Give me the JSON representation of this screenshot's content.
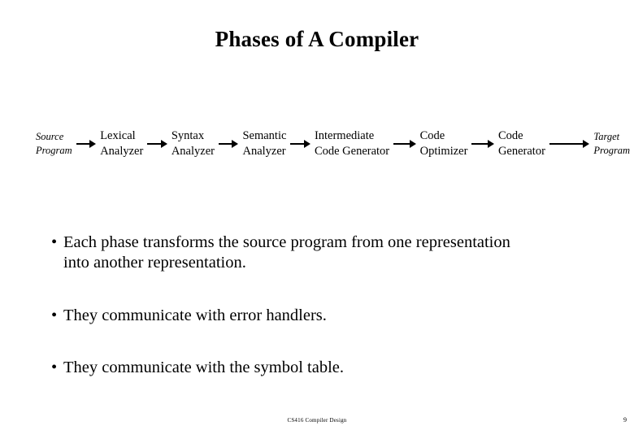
{
  "slide": {
    "title": "Phases of A Compiler",
    "page_number": "9",
    "footer": "CS416 Compiler Design",
    "background_color": "#ffffff",
    "text_color": "#000000"
  },
  "diagram": {
    "type": "flow",
    "orientation": "left-to-right",
    "nodes": [
      {
        "id": "source-program",
        "line1": "Source",
        "line2": "Program",
        "style": "italic",
        "role": "endpoint"
      },
      {
        "id": "lexical-analyzer",
        "line1": "Lexical",
        "line2": "Analyzer",
        "style": "regular",
        "role": "phase"
      },
      {
        "id": "syntax-analyzer",
        "line1": "Syntax",
        "line2": "Analyzer",
        "style": "regular",
        "role": "phase"
      },
      {
        "id": "semantic-analyzer",
        "line1": "Semantic",
        "line2": "Analyzer",
        "style": "regular",
        "role": "phase"
      },
      {
        "id": "intermediate-code-generator",
        "line1": "Intermediate",
        "line2": "Code Generator",
        "style": "regular",
        "role": "phase"
      },
      {
        "id": "code-optimizer",
        "line1": "Code",
        "line2": "Optimizer",
        "style": "regular",
        "role": "phase"
      },
      {
        "id": "code-generator",
        "line1": "Code",
        "line2": "Generator",
        "style": "regular",
        "role": "phase"
      },
      {
        "id": "target-program",
        "line1": "Target",
        "line2": "Program",
        "style": "italic",
        "role": "endpoint"
      }
    ],
    "arrows": [
      {
        "from": "source-program",
        "to": "lexical-analyzer",
        "length": "short"
      },
      {
        "from": "lexical-analyzer",
        "to": "syntax-analyzer",
        "length": "short"
      },
      {
        "from": "syntax-analyzer",
        "to": "semantic-analyzer",
        "length": "short"
      },
      {
        "from": "semantic-analyzer",
        "to": "intermediate-code-generator",
        "length": "short"
      },
      {
        "from": "intermediate-code-generator",
        "to": "code-optimizer",
        "length": "short"
      },
      {
        "from": "code-optimizer",
        "to": "code-generator",
        "length": "short"
      },
      {
        "from": "code-generator",
        "to": "target-program",
        "length": "long"
      }
    ]
  },
  "bullets": [
    {
      "marker": "•",
      "line1": "Each phase transforms the source program from one representation",
      "line2": "into another representation."
    },
    {
      "marker": "•",
      "line1": "They communicate with error handlers.",
      "line2": ""
    },
    {
      "marker": "•",
      "line1": "They communicate with the symbol table.",
      "line2": ""
    }
  ]
}
